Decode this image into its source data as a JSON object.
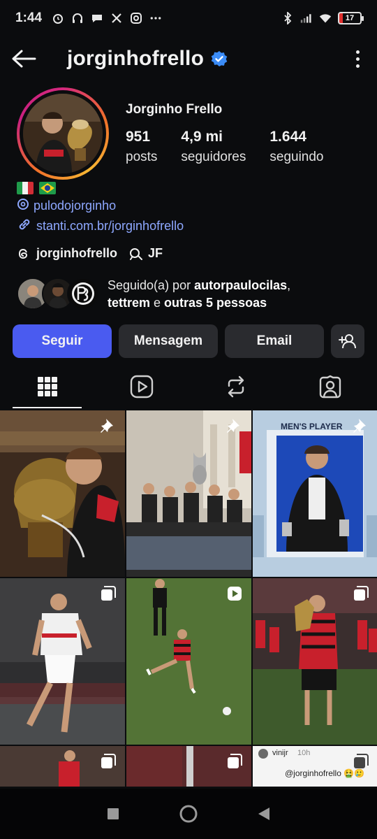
{
  "status_bar": {
    "time": "1:44",
    "battery": "17",
    "left_icons": [
      "alarm-icon",
      "headset-icon",
      "chat-icon",
      "x-icon",
      "instagram-icon",
      "more-dots-icon"
    ],
    "right_icons": [
      "bluetooth-icon",
      "signal-icon",
      "wifi-icon",
      "battery-icon"
    ]
  },
  "header": {
    "username": "jorginhofrello",
    "verified": true
  },
  "profile": {
    "name": "Jorginho Frello",
    "stats": [
      {
        "value": "951",
        "label": "posts"
      },
      {
        "value": "4,9 mi",
        "label": "seguidores"
      },
      {
        "value": "1.644",
        "label": "seguindo"
      }
    ],
    "flags": [
      "italy-flag",
      "brazil-flag"
    ],
    "bio_links": [
      {
        "icon": "threads-icon",
        "text": "pulodojorginho"
      },
      {
        "icon": "link-icon",
        "text": "stanti.com.br/jorginhofrello"
      }
    ],
    "threads_handle": "jorginhofrello",
    "threads_tag": "JF"
  },
  "followed_by": {
    "prefix": "Seguido(a) por ",
    "user1": "autorpaulocilas",
    "sep": ",",
    "user2": "tettrem",
    "mid": " e ",
    "others": "outras 5 pessoas"
  },
  "actions": {
    "follow": "Seguir",
    "message": "Mensagem",
    "email": "Email"
  },
  "tabs": [
    "grid-icon",
    "reels-icon",
    "reposts-icon",
    "tagged-icon"
  ],
  "grid": {
    "cell3_title": "MEN'S PLAYER",
    "cell9_user": "vinijr",
    "cell9_time": "10h",
    "cell9_caption": "@jorginhofrello 🤮🥲"
  },
  "colors": {
    "accent": "#4a5bf0",
    "link": "#8ea8ff",
    "background": "#0b0c0e",
    "button": "#2a2b2f"
  }
}
